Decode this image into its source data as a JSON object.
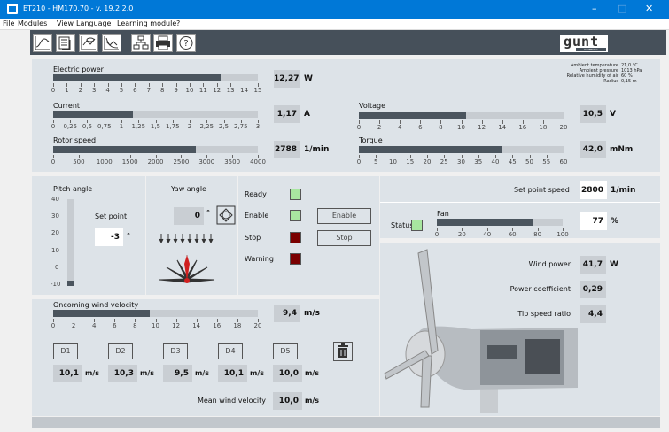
{
  "window": {
    "title": "ET210 - HM170.70 - v. 19.2.2.0"
  },
  "menu": [
    "File",
    "Modules",
    "View",
    "Language",
    "Learning module",
    "?"
  ],
  "toolbar_icons": [
    "trend-chart-icon",
    "data-table-icon",
    "signal-view-icon",
    "curve-icon",
    "structure-icon",
    "print-icon",
    "help-icon"
  ],
  "logo": {
    "text": "gunt",
    "sub": "HAMBURG"
  },
  "ambient": [
    {
      "label": "Ambient temperature",
      "value": "21,0 °C"
    },
    {
      "label": "Ambient pressure",
      "value": "1013 hPa"
    },
    {
      "label": "Relative humidity of air",
      "value": "60 %"
    },
    {
      "label": "Radius",
      "value": "0,15 m"
    }
  ],
  "electric_power": {
    "label": "Electric power",
    "value": "12,27",
    "unit": "W",
    "level": 0.818,
    "ticks": [
      "0",
      "1",
      "2",
      "3",
      "4",
      "5",
      "6",
      "7",
      "8",
      "9",
      "10",
      "11",
      "12",
      "13",
      "14",
      "15"
    ]
  },
  "current": {
    "label": "Current",
    "value": "1,17",
    "unit": "A",
    "level": 0.39,
    "ticks": [
      "0",
      "0,25",
      "0,5",
      "0,75",
      "1",
      "1,25",
      "1,5",
      "1,75",
      "2",
      "2,25",
      "2,5",
      "2,75",
      "3"
    ]
  },
  "rotor_speed": {
    "label": "Rotor speed",
    "value": "2788",
    "unit": "1/min",
    "level": 0.697,
    "ticks": [
      "0",
      "500",
      "1000",
      "1500",
      "2000",
      "2500",
      "3000",
      "3500",
      "4000"
    ]
  },
  "voltage": {
    "label": "Voltage",
    "value": "10,5",
    "unit": "V",
    "level": 0.525,
    "ticks": [
      "0",
      "2",
      "4",
      "6",
      "8",
      "10",
      "12",
      "14",
      "16",
      "18",
      "20"
    ]
  },
  "torque": {
    "label": "Torque",
    "value": "42,0",
    "unit": "mNm",
    "level": 0.7,
    "ticks": [
      "0",
      "5",
      "10",
      "15",
      "20",
      "25",
      "30",
      "35",
      "40",
      "45",
      "50",
      "55",
      "60"
    ]
  },
  "pitch": {
    "label": "Pitch angle",
    "set_point_label": "Set point",
    "value": "-3",
    "unit": "°",
    "level": 0.06,
    "ticks": [
      "40",
      "30",
      "20",
      "10",
      "0",
      "-10"
    ]
  },
  "yaw": {
    "label": "Yaw angle",
    "value": "0",
    "unit": "°"
  },
  "status": {
    "ready": "Ready",
    "enable": "Enable",
    "stop": "Stop",
    "warning": "Warning",
    "enable_btn": "Enable",
    "stop_btn": "Stop",
    "colors": {
      "green": "#a8e6a0",
      "red": "#7a0000"
    }
  },
  "set_point_speed": {
    "label": "Set point speed",
    "value": "2800",
    "unit": "1/min"
  },
  "fan": {
    "status_label": "Status",
    "label": "Fan",
    "value": "77",
    "unit": "%",
    "level": 0.77,
    "ticks": [
      "0",
      "20",
      "40",
      "60",
      "80",
      "100"
    ]
  },
  "results": [
    {
      "label": "Wind power",
      "value": "41,7",
      "unit": "W"
    },
    {
      "label": "Power coefficient",
      "value": "0,29",
      "unit": ""
    },
    {
      "label": "Tip speed ratio",
      "value": "4,4",
      "unit": ""
    }
  ],
  "wind": {
    "label": "Oncoming wind velocity",
    "value": "9,4",
    "unit": "m/s",
    "level": 0.47,
    "ticks": [
      "0",
      "2",
      "4",
      "6",
      "8",
      "10",
      "12",
      "14",
      "16",
      "18",
      "20"
    ]
  },
  "points": [
    {
      "button": "D1",
      "value": "10,1",
      "unit": "m/s"
    },
    {
      "button": "D2",
      "value": "10,3",
      "unit": "m/s"
    },
    {
      "button": "D3",
      "value": "9,5",
      "unit": "m/s"
    },
    {
      "button": "D4",
      "value": "10,1",
      "unit": "m/s"
    },
    {
      "button": "D5",
      "value": "10,0",
      "unit": "m/s"
    }
  ],
  "mean": {
    "label": "Mean wind velocity",
    "value": "10,0",
    "unit": "m/s"
  }
}
